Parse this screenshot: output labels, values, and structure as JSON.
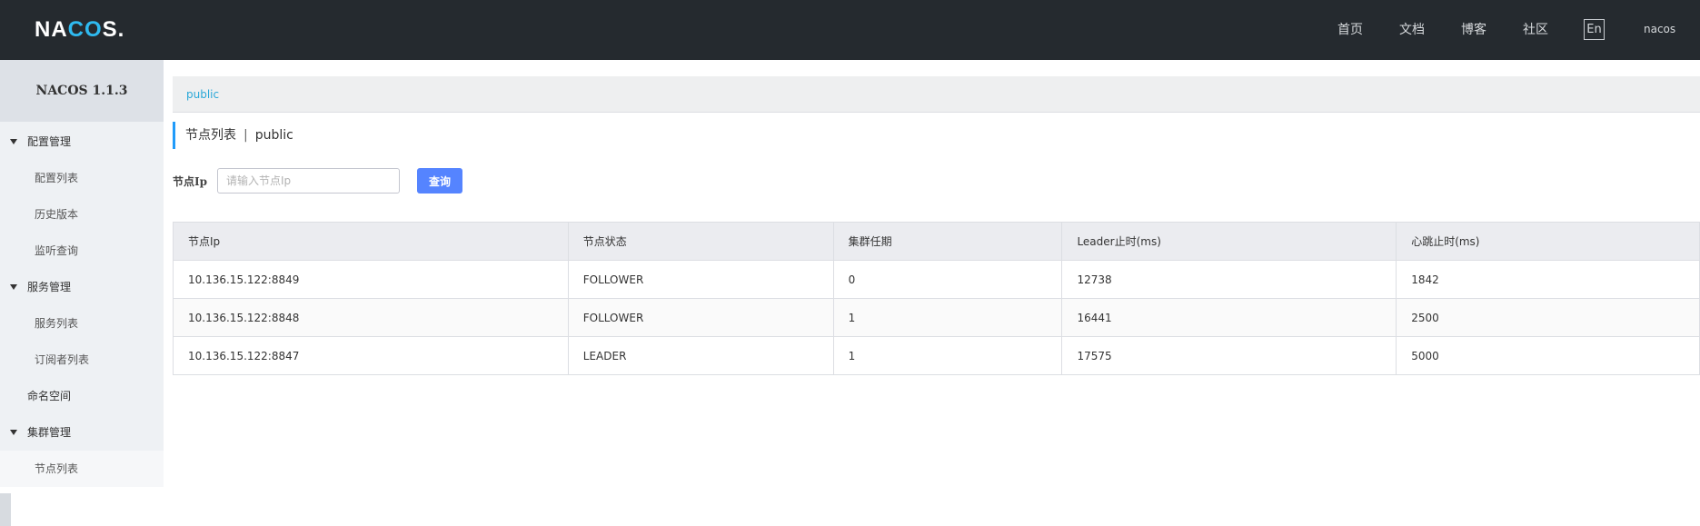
{
  "header": {
    "logo_text_a": "NA",
    "logo_text_c": "CO",
    "logo_text_b": "S.",
    "nav": [
      "首页",
      "文档",
      "博客",
      "社区"
    ],
    "lang_button": "En",
    "user": "nacos"
  },
  "sidebar": {
    "title": "NACOS 1.1.3",
    "groups": [
      {
        "label": "配置管理",
        "items": [
          "配置列表",
          "历史版本",
          "监听查询"
        ]
      },
      {
        "label": "服务管理",
        "items": [
          "服务列表",
          "订阅者列表"
        ]
      },
      {
        "label": "命名空间"
      },
      {
        "label": "集群管理",
        "items": [
          "节点列表"
        ]
      }
    ],
    "active_item": "节点列表"
  },
  "main": {
    "namespace_link": "public",
    "title": "节点列表",
    "title_sep": "|",
    "title_ns": "public",
    "search": {
      "label": "节点Ip",
      "placeholder": "请输入节点Ip",
      "value": "",
      "button": "查询"
    },
    "table": {
      "columns": [
        "节点Ip",
        "节点状态",
        "集群任期",
        "Leader止时(ms)",
        "心跳止时(ms)"
      ],
      "rows": [
        [
          "10.136.15.122:8849",
          "FOLLOWER",
          "0",
          "12738",
          "1842"
        ],
        [
          "10.136.15.122:8848",
          "FOLLOWER",
          "1",
          "16441",
          "2500"
        ],
        [
          "10.136.15.122:8847",
          "LEADER",
          "1",
          "17575",
          "5000"
        ]
      ]
    }
  },
  "colors": {
    "topbar": "#252a2f",
    "accent": "#5584ff",
    "link": "#2aa8d8",
    "logo_accent": "#2fbaf0"
  }
}
